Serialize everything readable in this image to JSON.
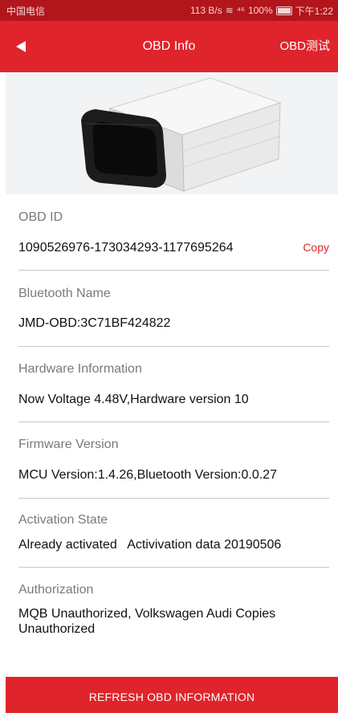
{
  "status_bar": {
    "carrier": "中国电信",
    "net_speed": "113 B/s",
    "signal": "⁴⁶",
    "battery": "100%",
    "time": "下午1:22"
  },
  "appbar": {
    "title": "OBD Info",
    "action_label": "OBD测试"
  },
  "fields": {
    "obd_id": {
      "label": "OBD ID",
      "value": "1090526976-173034293-1177695264",
      "copy_label": "Copy"
    },
    "bluetooth_name": {
      "label": "Bluetooth Name",
      "value": "JMD-OBD:3C71BF424822"
    },
    "hardware": {
      "label": "Hardware Information",
      "value": "Now Voltage 4.48V,Hardware version 10"
    },
    "firmware": {
      "label": "Firmware Version",
      "value": "MCU Version:1.4.26,Bluetooth Version:0.0.27"
    },
    "activation": {
      "label": "Activation State",
      "value": "Already activated   Activivation data 20190506"
    },
    "authorization": {
      "label": "Authorization",
      "value": "MQB Unauthorized, Volkswagen Audi Copies Unauthorized"
    }
  },
  "refresh_button": "REFRESH OBD INFORMATION",
  "colors": {
    "primary": "#e0242b",
    "status_bar": "#b3151c",
    "divider": "#c8c8c8"
  }
}
